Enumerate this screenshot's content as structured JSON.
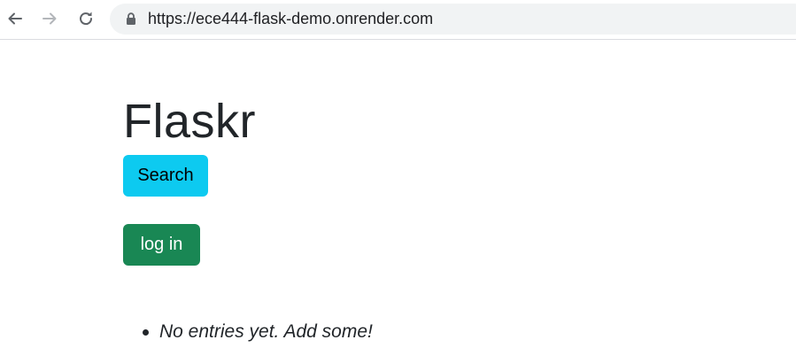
{
  "browser": {
    "back_icon": "arrow-left-icon",
    "forward_icon": "arrow-right-icon",
    "reload_icon": "reload-icon",
    "lock_icon": "lock-icon",
    "url": "https://ece444-flask-demo.onrender.com"
  },
  "page": {
    "title": "Flaskr",
    "search_button": "Search",
    "login_button": "log in",
    "entries": [
      {
        "text": "No entries yet. Add some!"
      }
    ]
  },
  "colors": {
    "search_button_bg": "#0dcaf0",
    "login_button_bg": "#198754",
    "text": "#212529"
  }
}
